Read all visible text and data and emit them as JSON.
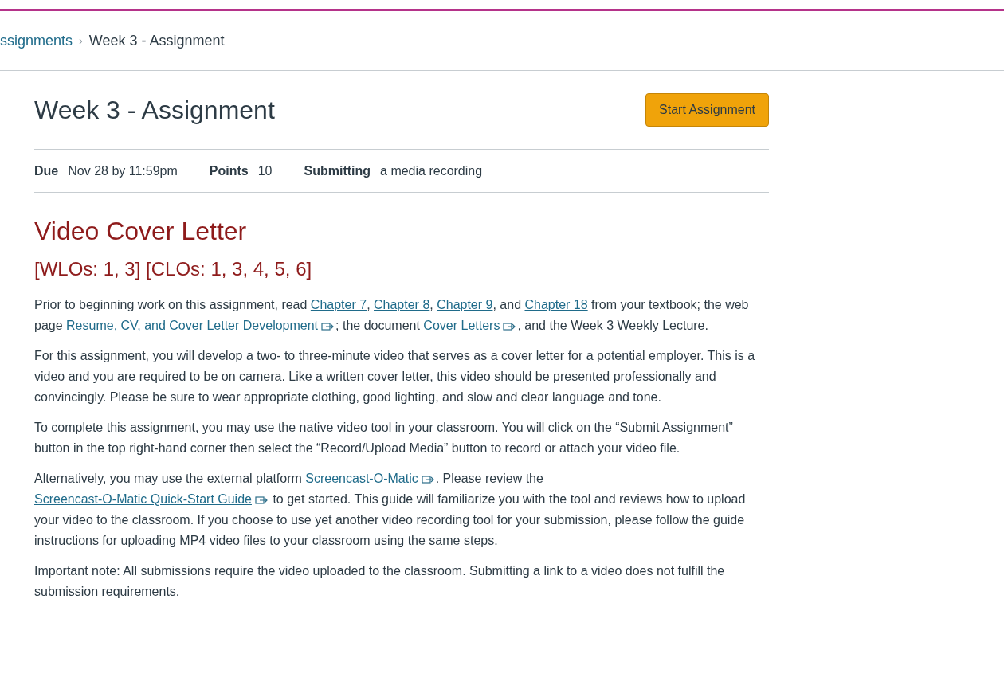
{
  "breadcrumb": [
    {
      "label": "ssignments",
      "kind": "link"
    },
    {
      "label": "Week 3 - Assignment",
      "kind": "current"
    }
  ],
  "breadcrumb_separator": "›",
  "title": "Week 3 - Assignment",
  "start_button": "Start Assignment",
  "details": [
    {
      "label": "Due",
      "value": "Nov 28 by 11:59pm"
    },
    {
      "label": "Points",
      "value": "10"
    },
    {
      "label": "Submitting",
      "value": "a media recording"
    }
  ],
  "heading": "Video Cover Letter",
  "subheading": "[WLOs: 1, 3] [CLOs: 1, 3, 4, 5, 6]",
  "paragraphs": [
    {
      "parts": [
        {
          "kind": "text",
          "text": "Prior to beginning work on this assignment, read "
        },
        {
          "kind": "link",
          "text": "Chapter 7",
          "external": false
        },
        {
          "kind": "text",
          "text": ", "
        },
        {
          "kind": "link",
          "text": "Chapter 8",
          "external": false
        },
        {
          "kind": "text",
          "text": ", "
        },
        {
          "kind": "link",
          "text": "Chapter 9",
          "external": false
        },
        {
          "kind": "text",
          "text": ", and "
        },
        {
          "kind": "link",
          "text": "Chapter 18",
          "external": false
        },
        {
          "kind": "text",
          "text": " from your textbook; the web page "
        },
        {
          "kind": "link",
          "text": "Resume, CV, and Cover Letter Development",
          "external": true
        },
        {
          "kind": "text",
          "text": "; the document "
        },
        {
          "kind": "link",
          "text": "Cover Letters",
          "external": true
        },
        {
          "kind": "text",
          "text": ", and the Week 3 Weekly Lecture."
        }
      ]
    },
    {
      "parts": [
        {
          "kind": "text",
          "text": "For this assignment, you will develop a two- to three-minute video that serves as a cover letter for a potential employer. This is a video and you are required to be on camera. Like a written cover letter, this video should be presented professionally and convincingly. Please be sure to wear appropriate clothing, good lighting, and slow and clear language and tone."
        }
      ]
    },
    {
      "parts": [
        {
          "kind": "text",
          "text": "To complete this assignment, you may use the native video tool in your classroom. You will click on the “Submit Assignment” button in the top right-hand corner then select the “Record/Upload Media” button to record or attach your video file."
        }
      ]
    },
    {
      "parts": [
        {
          "kind": "text",
          "text": "Alternatively, you may use the external platform "
        },
        {
          "kind": "link",
          "text": "Screencast-O-Matic",
          "external": true
        },
        {
          "kind": "text",
          "text": ". Please review the "
        },
        {
          "kind": "link",
          "text": "Screencast-O-Matic Quick-Start Guide",
          "external": true
        },
        {
          "kind": "text",
          "text": " to get started. This guide will familiarize you with the tool and reviews how to upload your video to the classroom. If you choose to use yet another video recording tool for your submission, please follow the guide instructions for uploading MP4 video files to your classroom using the same steps."
        }
      ]
    },
    {
      "parts": [
        {
          "kind": "text",
          "text": "Important note: All submissions require the video uploaded to the classroom. Submitting a link to a video does not fulfill the submission requirements."
        }
      ]
    }
  ]
}
